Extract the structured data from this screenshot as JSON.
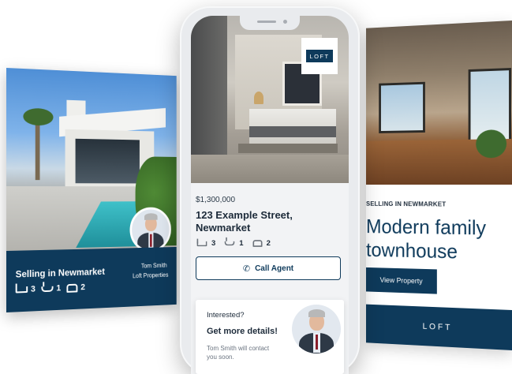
{
  "left_card": {
    "heading": "Selling in Newmarket",
    "agent_name": "Tom Smith",
    "agent_company": "Loft Properties",
    "beds": "3",
    "baths": "1",
    "cars": "2"
  },
  "phone": {
    "brand_badge": "LOFT",
    "price": "$1,300,000",
    "address": "123 Example Street, Newmarket",
    "beds": "3",
    "baths": "1",
    "cars": "2",
    "call_button": "Call Agent",
    "interest": {
      "question": "Interested?",
      "title": "Get more details!",
      "body": "Tom Smith will contact you soon."
    }
  },
  "right_card": {
    "subheading": "SELLING IN NEWMARKET",
    "title": "Modern family townhouse",
    "button": "View Property",
    "brand": "LOFT"
  },
  "colors": {
    "brand_navy": "#0e3a5b",
    "background": "#ffffff"
  }
}
